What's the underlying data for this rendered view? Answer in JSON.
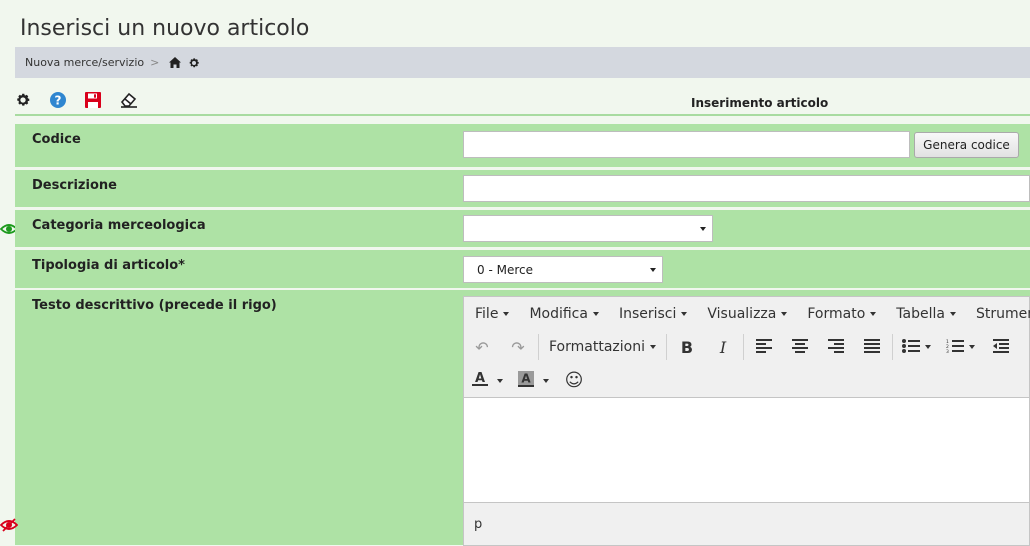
{
  "page": {
    "title": "Inserisci un nuovo articolo"
  },
  "breadcrumb": {
    "item": "Nuova merce/servizio",
    "separator": ">"
  },
  "toolbar": {
    "icons": [
      "gear-icon",
      "help-icon",
      "save-icon",
      "eraser-icon"
    ],
    "colors": {
      "help": "#2f86d0",
      "save": "#d9001b"
    }
  },
  "section": {
    "title": "Inserimento articolo"
  },
  "form": {
    "codice": {
      "label": "Codice",
      "value": "",
      "generate_label": "Genera codice"
    },
    "descrizione": {
      "label": "Descrizione",
      "value": ""
    },
    "categoria": {
      "label": "Categoria merceologica",
      "selected": ""
    },
    "tipologia": {
      "label": "Tipologia di articolo*",
      "selected": "0 - Merce"
    },
    "testo": {
      "label": "Testo descrittivo (precede il rigo)"
    }
  },
  "editor": {
    "menus": [
      "File",
      "Modifica",
      "Inserisci",
      "Visualizza",
      "Formato",
      "Tabella",
      "Strumenti"
    ],
    "format_label": "Formattazioni",
    "status_path": "p"
  },
  "colors": {
    "row_bg": "#aee2a5",
    "accent_eye_green": "#1d9a1d",
    "accent_eye_red": "#d9001b"
  }
}
